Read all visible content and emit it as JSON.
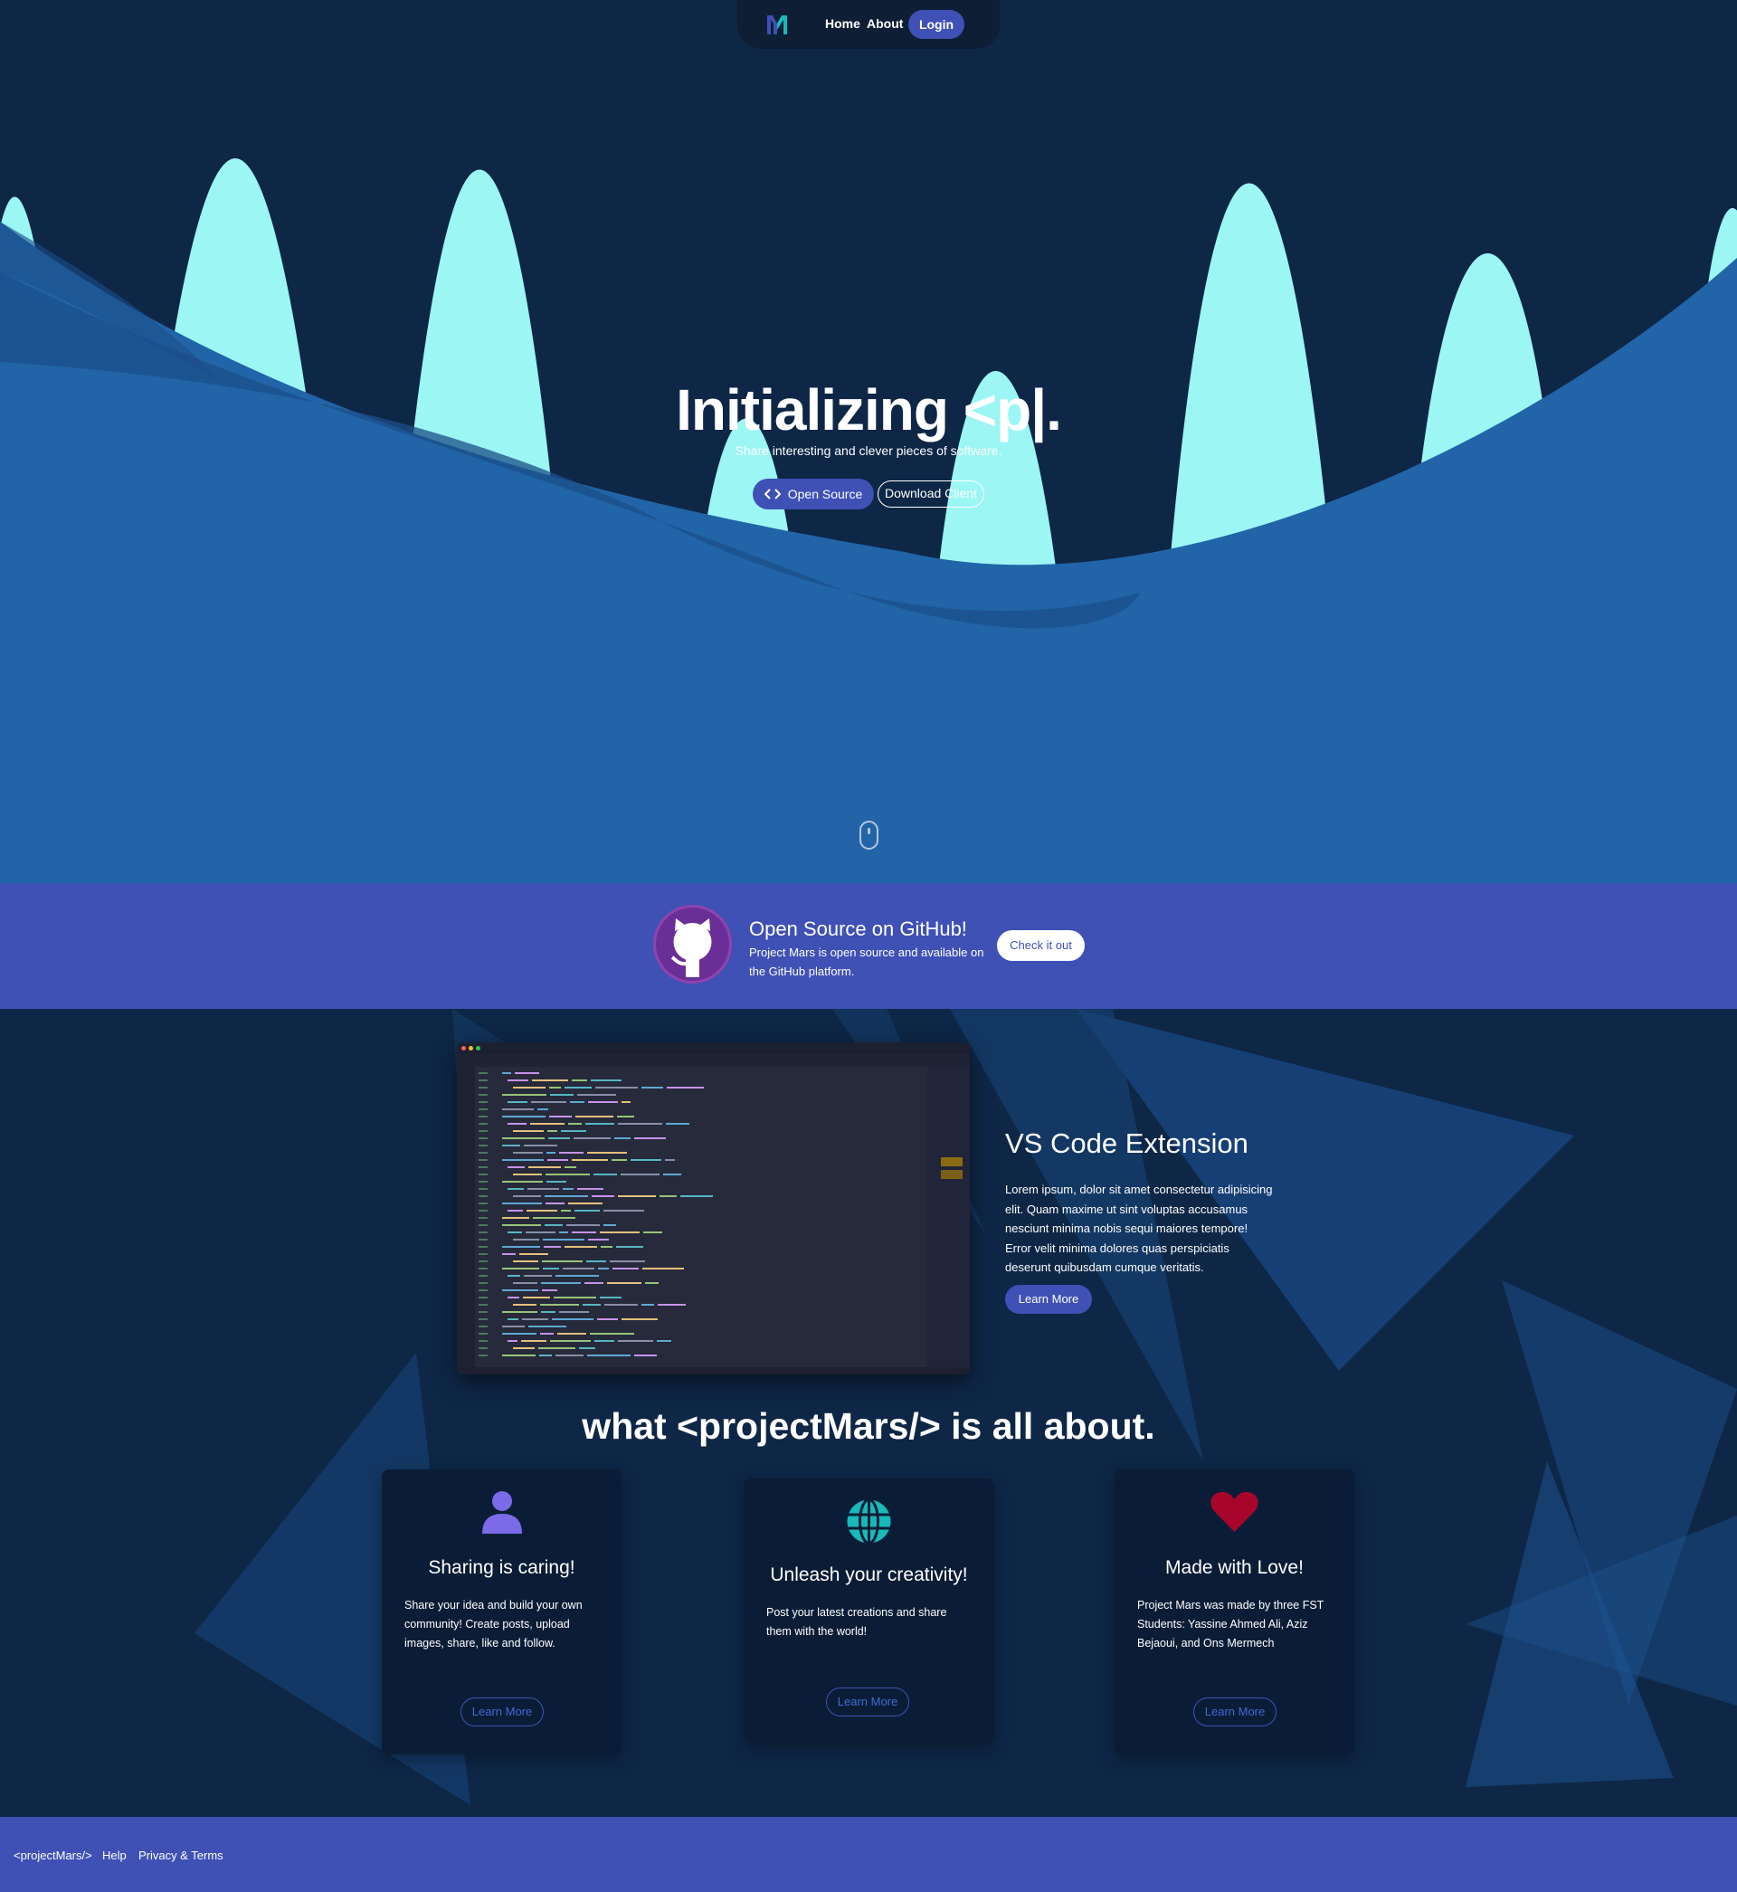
{
  "nav": {
    "home_label": "Home",
    "about_label": "About",
    "login_label": "Login"
  },
  "hero": {
    "title": "Initializing <p|.",
    "subtitle": "Share interesting and clever pieces of software.",
    "open_source_label": "Open Source",
    "download_label": "Download Client"
  },
  "github_banner": {
    "title": "Open Source on GitHub!",
    "text": "Project Mars is open source and available on the GitHub platform.",
    "button_label": "Check it out"
  },
  "vscode": {
    "title": "VS Code Extension",
    "text": "Lorem ipsum, dolor sit amet consectetur adipisicing elit. Quam maxime ut sint voluptas accusamus nesciunt minima nobis sequi maiores tempore! Error velit minima dolores quas perspiciatis deserunt quibusdam cumque veritatis.",
    "button_label": "Learn More"
  },
  "about": {
    "title": "what <projectMars/> is all about.",
    "cards": [
      {
        "icon": "user-icon",
        "title": "Sharing is caring!",
        "text": "Share your idea and build your own community! Create posts, upload images, share, like and follow.",
        "button_label": "Learn More"
      },
      {
        "icon": "globe-icon",
        "title": "Unleash your creativity!",
        "text": "Post your latest creations and share them with the world!",
        "button_label": "Learn More"
      },
      {
        "icon": "heart-icon",
        "title": "Made with Love!",
        "text": "Project Mars was made by three FST Students: Yassine Ahmed Ali, Aziz Bejaoui, and Ons Mermech",
        "button_label": "Learn More"
      }
    ]
  },
  "footer": {
    "brand": "<projectMars/>",
    "help": "Help",
    "privacy": "Privacy & Terms"
  },
  "colors": {
    "primary": "#3f51b5",
    "navy": "#0e2747",
    "hero_wave": "#2164a8",
    "spike": "#9bf6f4",
    "heart": "#a8052c",
    "user_icon": "#7b6be8",
    "globe_icon": "#19b8b9"
  }
}
